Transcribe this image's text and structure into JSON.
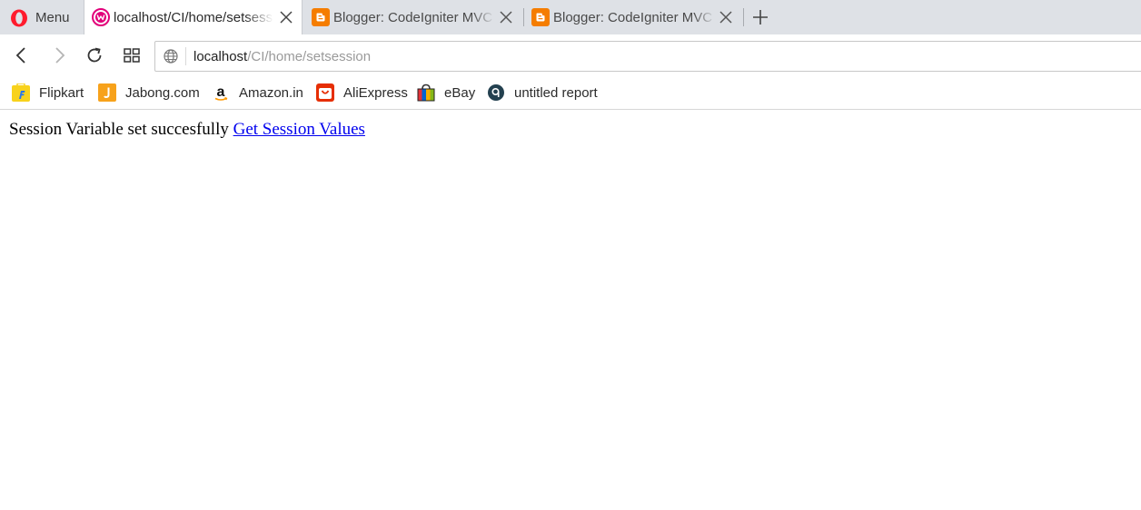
{
  "browser": {
    "menu_label": "Menu",
    "tabs": [
      {
        "title": "localhost/CI/home/setsession",
        "active": true,
        "favicon": "wampserver-icon"
      },
      {
        "title": "Blogger: CodeIgniter MVC",
        "active": false,
        "favicon": "blogger-icon"
      },
      {
        "title": "Blogger: CodeIgniter MVC",
        "active": false,
        "favicon": "blogger-icon"
      }
    ],
    "address": {
      "host": "localhost",
      "path": "/CI/home/setsession"
    },
    "bookmarks": [
      {
        "label": "Flipkart",
        "icon": "flipkart-icon"
      },
      {
        "label": "Jabong.com",
        "icon": "jabong-icon"
      },
      {
        "label": "Amazon.in",
        "icon": "amazon-icon"
      },
      {
        "label": "AliExpress",
        "icon": "aliexpress-icon"
      },
      {
        "label": "eBay",
        "icon": "ebay-icon"
      },
      {
        "label": "untitled report",
        "icon": "report-icon"
      }
    ],
    "colors": {
      "opera_red": "#ff1b2d",
      "blogger_orange": "#f57d00",
      "wamp_magenta": "#e2007a",
      "link_blue": "#0000ee"
    }
  },
  "page": {
    "message": "Session Variable set succesfully",
    "link_label": "Get Session Values"
  }
}
